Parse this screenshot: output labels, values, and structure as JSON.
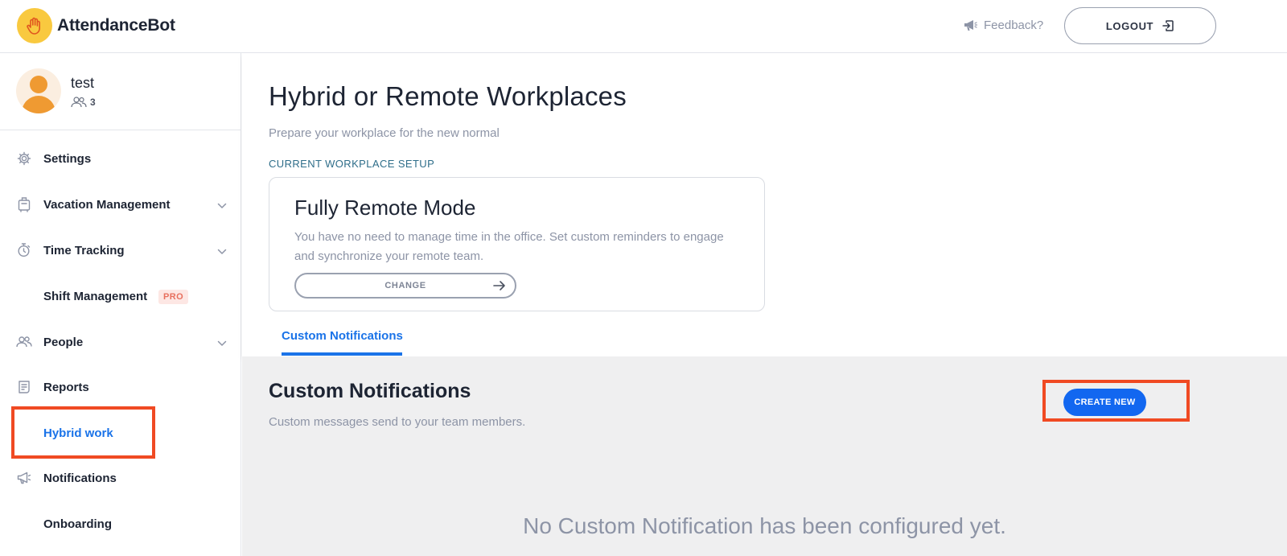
{
  "header": {
    "brand": "AttendanceBot",
    "feedback_label": "Feedback?",
    "logout_label": "LOGOUT"
  },
  "profile": {
    "name": "test",
    "member_count": "3"
  },
  "sidebar": {
    "items": [
      {
        "label": "Settings",
        "icon": "gear-icon",
        "has_chevron": false
      },
      {
        "label": "Vacation Management",
        "icon": "luggage-icon",
        "has_chevron": true
      },
      {
        "label": "Time Tracking",
        "icon": "stopwatch-icon",
        "has_chevron": true
      },
      {
        "label": "Shift Management",
        "icon": "",
        "badge": "PRO",
        "has_chevron": false
      },
      {
        "label": "People",
        "icon": "people-icon",
        "has_chevron": true
      },
      {
        "label": "Reports",
        "icon": "reports-icon",
        "has_chevron": false
      },
      {
        "label": "Hybrid work",
        "icon": "",
        "active": true,
        "has_chevron": false
      },
      {
        "label": "Notifications",
        "icon": "megaphone-icon",
        "has_chevron": false
      },
      {
        "label": "Onboarding",
        "icon": "",
        "has_chevron": false
      }
    ]
  },
  "main": {
    "title": "Hybrid or Remote Workplaces",
    "subtitle": "Prepare your workplace for the new normal",
    "setup_label": "CURRENT WORKPLACE SETUP",
    "card": {
      "title": "Fully Remote Mode",
      "description": "You have no need to manage time in the office. Set custom reminders to engage and synchronize your remote team.",
      "change_label": "CHANGE"
    },
    "tab_label": "Custom Notifications",
    "section": {
      "title": "Custom Notifications",
      "subtitle": "Custom messages send to your team members.",
      "create_label": "CREATE NEW",
      "empty_message": "No Custom Notification has been configured yet."
    }
  },
  "colors": {
    "accent": "#1a73e8",
    "create_button": "#1267f0",
    "highlight": "#f04a23",
    "logo": "#f9c93f"
  }
}
